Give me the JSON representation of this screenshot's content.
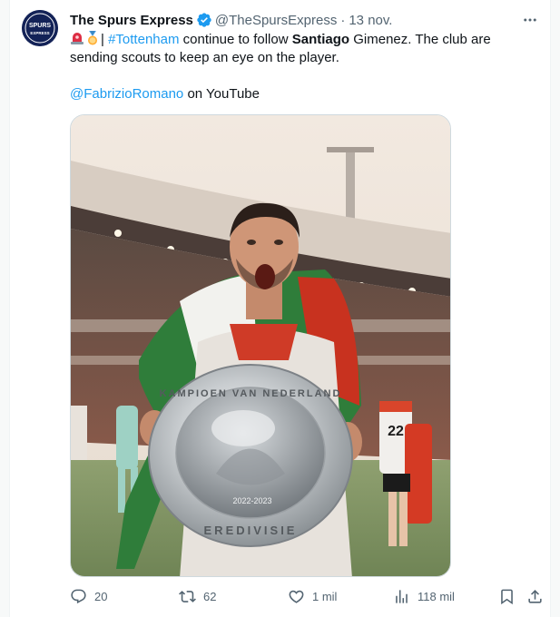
{
  "tweet": {
    "author_name": "The Spurs Express",
    "handle": "@TheSpursExpress",
    "separator": "·",
    "timestamp": "13 nov.",
    "text_prefix": "| ",
    "hashtag": "#Tottenham",
    "text_middle": " continue to follow ",
    "bold_name": "Santiago",
    "text_rest": " Gimenez. The club are sending scouts to keep an eye on the player.",
    "mention": "@FabrizioRomano",
    "mention_suffix": " on YouTube",
    "avatar_text_top": "SPURS",
    "avatar_text_bottom": "EXPRESS",
    "trophy_text": "KAMPIOEN VAN NEDERLAND",
    "trophy_text_bottom": "EREDIVISIE",
    "trophy_year": "2022-2023",
    "shirt_number": "22",
    "colors": {
      "accent": "#1d9bf0",
      "avatar_bg": "#132257",
      "verified": "#1d9bf0"
    }
  },
  "actions": {
    "replies": "20",
    "retweets": "62",
    "likes": "1 mil",
    "views": "118 mil"
  }
}
